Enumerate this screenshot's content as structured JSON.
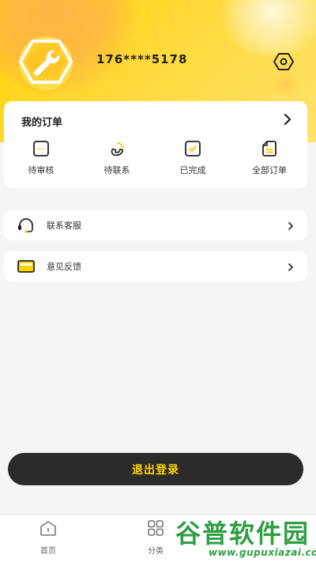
{
  "colors": {
    "brand_yellow": "#ffd400",
    "logout_bg": "#2b2b2b",
    "logout_text": "#ffd400",
    "page_bg": "#f4f5f7",
    "watermark_green": "#2f9e44"
  },
  "profile": {
    "avatar_icon": "wrench-icon",
    "phone": "176****5178",
    "settings_icon": "gear-icon"
  },
  "orders": {
    "title": "我的订单",
    "items": [
      {
        "label": "待审核",
        "icon": "pending-review-icon"
      },
      {
        "label": "待联系",
        "icon": "phone-icon"
      },
      {
        "label": "已完成",
        "icon": "checkbox-icon"
      },
      {
        "label": "全部订单",
        "icon": "document-icon"
      }
    ]
  },
  "menu": {
    "customer_service": {
      "label": "联系客服",
      "icon": "headset-icon"
    },
    "feedback": {
      "label": "意见反馈",
      "icon": "envelope-icon"
    }
  },
  "logout_label": "退出登录",
  "tabbar": {
    "tabs": [
      {
        "label": "首页",
        "icon": "home-icon"
      },
      {
        "label": "分类",
        "icon": "grid-icon"
      }
    ]
  },
  "watermark": {
    "text": "谷普软件园",
    "url": "www.gupuxiazai.com"
  }
}
